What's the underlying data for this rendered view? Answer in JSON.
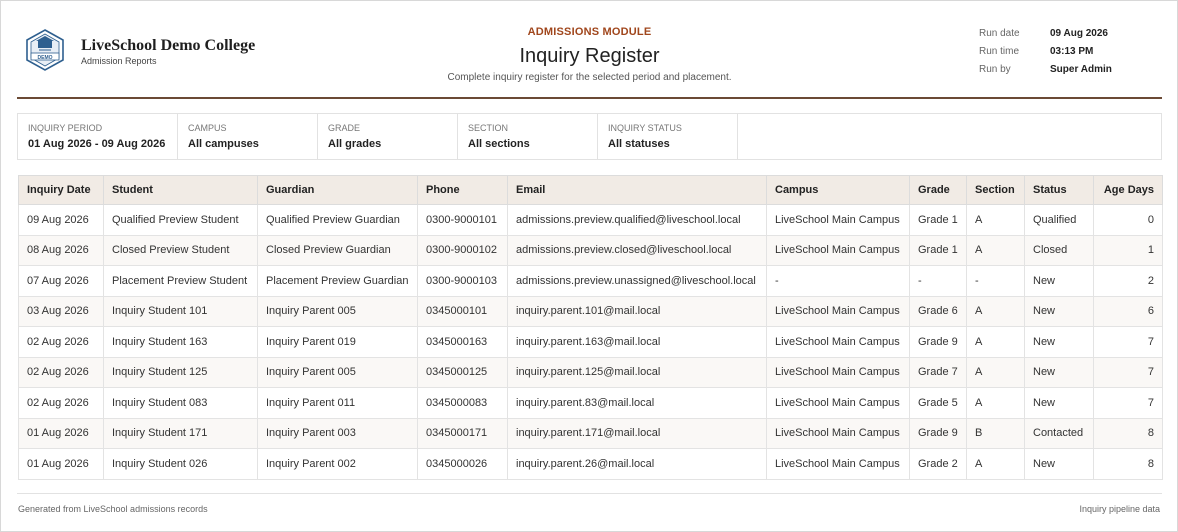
{
  "header": {
    "school_name": "LiveSchool Demo College",
    "school_sub": "Admission Reports",
    "logo_text": "DEMO",
    "module": "ADMISSIONS MODULE",
    "title": "Inquiry Register",
    "subtitle": "Complete inquiry register for the selected period and placement."
  },
  "meta": [
    {
      "label": "Run date",
      "value": "09 Aug 2026"
    },
    {
      "label": "Run time",
      "value": "03:13 PM"
    },
    {
      "label": "Run by",
      "value": "Super Admin"
    }
  ],
  "filters": [
    {
      "label": "INQUIRY PERIOD",
      "value": "01 Aug 2026 - 09 Aug 2026"
    },
    {
      "label": "CAMPUS",
      "value": "All campuses"
    },
    {
      "label": "GRADE",
      "value": "All grades"
    },
    {
      "label": "SECTION",
      "value": "All sections"
    },
    {
      "label": "INQUIRY STATUS",
      "value": "All statuses"
    }
  ],
  "table": {
    "headers": [
      "Inquiry Date",
      "Student",
      "Guardian",
      "Phone",
      "Email",
      "Campus",
      "Grade",
      "Section",
      "Status",
      "Age Days"
    ],
    "rows": [
      [
        "09 Aug 2026",
        "Qualified Preview Student",
        "Qualified Preview Guardian",
        "0300-9000101",
        "admissions.preview.qualified@liveschool.local",
        "LiveSchool Main Campus",
        "Grade 1",
        "A",
        "Qualified",
        "0"
      ],
      [
        "08 Aug 2026",
        "Closed Preview Student",
        "Closed Preview Guardian",
        "0300-9000102",
        "admissions.preview.closed@liveschool.local",
        "LiveSchool Main Campus",
        "Grade 1",
        "A",
        "Closed",
        "1"
      ],
      [
        "07 Aug 2026",
        "Placement Preview Student",
        "Placement Preview Guardian",
        "0300-9000103",
        "admissions.preview.unassigned@liveschool.local",
        "-",
        "-",
        "-",
        "New",
        "2"
      ],
      [
        "03 Aug 2026",
        "Inquiry Student 101",
        "Inquiry Parent 005",
        "0345000101",
        "inquiry.parent.101@mail.local",
        "LiveSchool Main Campus",
        "Grade 6",
        "A",
        "New",
        "6"
      ],
      [
        "02 Aug 2026",
        "Inquiry Student 163",
        "Inquiry Parent 019",
        "0345000163",
        "inquiry.parent.163@mail.local",
        "LiveSchool Main Campus",
        "Grade 9",
        "A",
        "New",
        "7"
      ],
      [
        "02 Aug 2026",
        "Inquiry Student 125",
        "Inquiry Parent 005",
        "0345000125",
        "inquiry.parent.125@mail.local",
        "LiveSchool Main Campus",
        "Grade 7",
        "A",
        "New",
        "7"
      ],
      [
        "02 Aug 2026",
        "Inquiry Student 083",
        "Inquiry Parent 011",
        "0345000083",
        "inquiry.parent.83@mail.local",
        "LiveSchool Main Campus",
        "Grade 5",
        "A",
        "New",
        "7"
      ],
      [
        "01 Aug 2026",
        "Inquiry Student 171",
        "Inquiry Parent 003",
        "0345000171",
        "inquiry.parent.171@mail.local",
        "LiveSchool Main Campus",
        "Grade 9",
        "B",
        "Contacted",
        "8"
      ],
      [
        "01 Aug 2026",
        "Inquiry Student 026",
        "Inquiry Parent 002",
        "0345000026",
        "inquiry.parent.26@mail.local",
        "LiveSchool Main Campus",
        "Grade 2",
        "A",
        "New",
        "8"
      ]
    ]
  },
  "footer": {
    "left": "Generated from LiveSchool admissions records",
    "right": "Inquiry pipeline data"
  },
  "colors": {
    "accent": "#a0461c",
    "rule": "#6b4a35",
    "header_bg": "#f1ebe5",
    "logo_blue": "#2e5f8f"
  }
}
